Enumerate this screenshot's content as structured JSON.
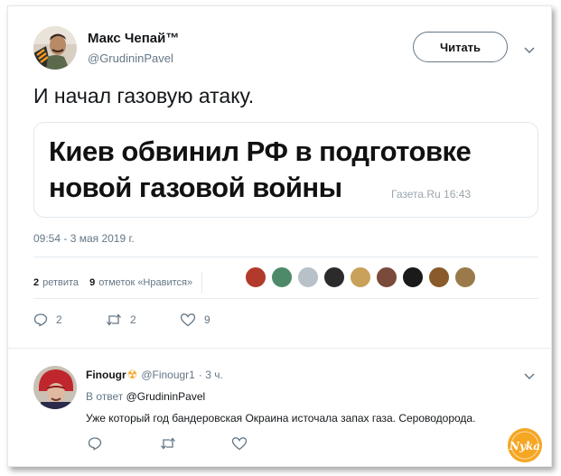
{
  "tweet": {
    "author_name": "Макс Чепай™",
    "author_handle": "@GrudininPavel",
    "follow_label": "Читать",
    "text": "И начал газовую атаку.",
    "card": {
      "headline": "Киев обвинил РФ в подготовке новой газовой войны",
      "source": "Газета.Ru 16:43"
    },
    "timestamp": "09:54 - 3 мая 2019 г.",
    "retweets_count": "2",
    "retweets_label": "ретвита",
    "likes_count": "9",
    "likes_label": "отметок «Нравится»",
    "likers": [
      "#b23a2a",
      "#4e8a6a",
      "#b8c0c8",
      "#2b2b2b",
      "#c9a15a",
      "#7a4a3a",
      "#1a1a1a",
      "#8a5a2a",
      "#9a7a4a"
    ],
    "actions": {
      "reply_count": "2",
      "retweet_count": "2",
      "like_count": "9"
    }
  },
  "reply": {
    "author_name": "Finougr",
    "emoji": "☢",
    "author_handle": "@Finougr1",
    "time": "· 3 ч.",
    "reply_prefix": "В ответ",
    "reply_to": "@GrudininPavel",
    "text": "Уже который год бандеровская Окраина источала запах газа. Сероводорода."
  },
  "watermark_text": "Nyka",
  "colors": {
    "muted": "#657786",
    "border": "#e1e8ed",
    "watermark": "#f5a623"
  }
}
